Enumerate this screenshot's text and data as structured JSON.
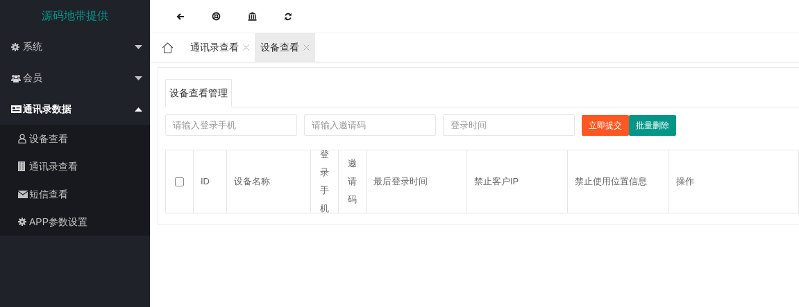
{
  "sidebar": {
    "logo": "源码地带提供",
    "items": [
      {
        "label": "系统",
        "expanded": false
      },
      {
        "label": "会员",
        "expanded": false
      },
      {
        "label": "通讯录数据",
        "expanded": true,
        "children": [
          {
            "label": "设备查看"
          },
          {
            "label": "通讯录查看"
          },
          {
            "label": "短信查看"
          },
          {
            "label": "APP参数设置"
          }
        ]
      }
    ]
  },
  "tabs": [
    {
      "label": "通讯录查看",
      "selected": false
    },
    {
      "label": "设备查看",
      "selected": true
    }
  ],
  "panel": {
    "title": "设备查看管理",
    "filters": [
      {
        "placeholder": "请输入登录手机"
      },
      {
        "placeholder": "请输入邀请码"
      },
      {
        "placeholder": "登录时间"
      }
    ],
    "buttons": [
      {
        "label": "立即提交",
        "kind": "submit"
      },
      {
        "label": "批量删除",
        "kind": "delete"
      }
    ],
    "table": {
      "select_all_checked": false,
      "columns": [
        "ID",
        "设备名称",
        "登录手机",
        "邀请码",
        "最后登录时间",
        "禁止客户IP",
        "禁止使用位置信息",
        "操作"
      ]
    }
  }
}
